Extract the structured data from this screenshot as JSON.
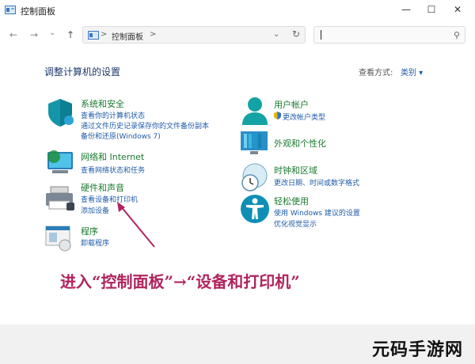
{
  "window": {
    "title": "控制面板"
  },
  "navbar": {
    "back": "←",
    "forward": "→",
    "history": "⌄",
    "up": "↑",
    "address_path": "控制面板",
    "address_chevron": ">",
    "dropdown": "⌄",
    "refresh": "↻",
    "search_placeholder": ""
  },
  "main": {
    "heading": "调整计算机的设置",
    "view_by_label": "查看方式:",
    "view_by_value": "类别 ▾"
  },
  "categories_left": [
    {
      "title": "系统和安全",
      "links": [
        "查看你的计算机状态",
        "通过文件历史记录保存你的文件备份副本",
        "备份和还原(Windows 7)"
      ]
    },
    {
      "title": "网络和 Internet",
      "links": [
        "查看网络状态和任务"
      ]
    },
    {
      "title": "硬件和声音",
      "links": [
        "查看设备和打印机",
        "添加设备"
      ]
    },
    {
      "title": "程序",
      "links": [
        "卸载程序"
      ]
    }
  ],
  "categories_right": [
    {
      "title": "用户帐户",
      "links": [
        "更改帐户类型"
      ]
    },
    {
      "title": "外观和个性化",
      "links": []
    },
    {
      "title": "时钟和区域",
      "links": [
        "更改日期、时间或数字格式"
      ]
    },
    {
      "title": "轻松使用",
      "links": [
        "使用 Windows 建议的设置",
        "优化视觉显示"
      ]
    }
  ],
  "annotation": "进入“控制面板”→“设备和打印机”",
  "watermark": "元码手游网",
  "colors": {
    "category_title": "#1a7a2e",
    "link": "#1f5ba8",
    "annotation": "#b0245e"
  }
}
